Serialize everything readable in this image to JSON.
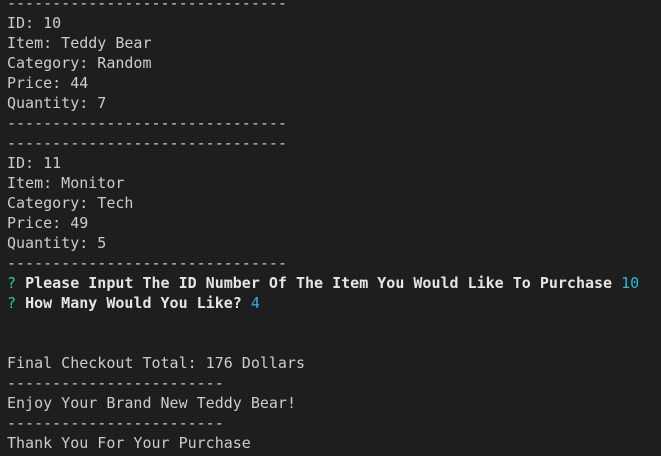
{
  "theme": {
    "background": "#1e1e1e",
    "foreground": "#cccccc",
    "prompt_marker_color": "#23d18b",
    "answer_color": "#29b8db"
  },
  "terminal": {
    "separator_long": "-------------------------------",
    "separator_short": "------------------------",
    "items": [
      {
        "id": "ID: 10",
        "item": "Item: Teddy Bear",
        "category": "Category: Random",
        "price": "Price: 44",
        "quantity": "Quantity: 7"
      },
      {
        "id": "ID: 11",
        "item": "Item: Monitor",
        "category": "Category: Tech",
        "price": "Price: 49",
        "quantity": "Quantity: 5"
      }
    ],
    "prompts": [
      {
        "marker": "?",
        "question": "Please Input The ID Number Of The Item You Would Like To Purchase",
        "answer": "10"
      },
      {
        "marker": "?",
        "question": "How Many Would You Like?",
        "answer": "4"
      }
    ],
    "final_total": "Final Checkout Total: 176 Dollars",
    "enjoy_message": "Enjoy Your Brand New Teddy Bear!",
    "thanks_message": "Thank You For Your Purchase"
  }
}
